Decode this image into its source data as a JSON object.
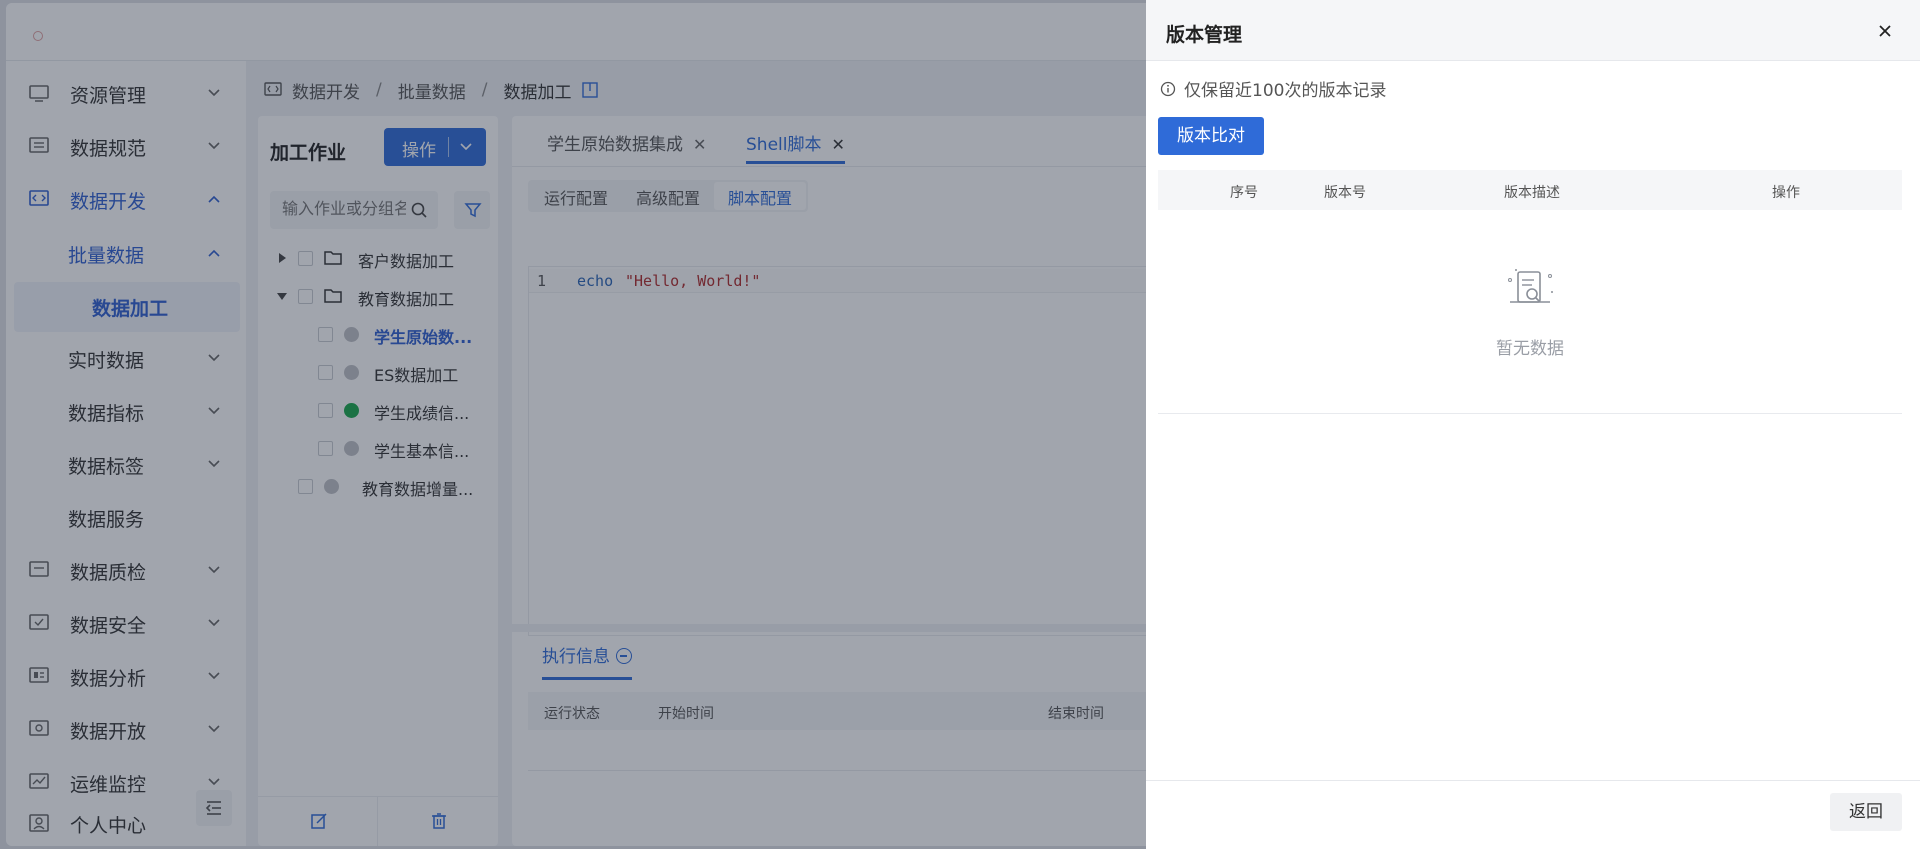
{
  "sidebar": {
    "items": [
      {
        "label": "资源管理",
        "icon": "monitor-icon"
      },
      {
        "label": "数据规范",
        "icon": "spec-icon"
      },
      {
        "label": "数据开发",
        "icon": "code-icon"
      },
      {
        "label": "批量数据"
      },
      {
        "label": "数据加工"
      },
      {
        "label": "实时数据"
      },
      {
        "label": "数据指标"
      },
      {
        "label": "数据标签"
      },
      {
        "label": "数据服务"
      },
      {
        "label": "数据质检",
        "icon": "quality-icon"
      },
      {
        "label": "数据安全",
        "icon": "security-icon"
      },
      {
        "label": "数据分析",
        "icon": "analysis-icon"
      },
      {
        "label": "数据开放",
        "icon": "open-icon"
      },
      {
        "label": "运维监控",
        "icon": "monitor-chart-icon"
      },
      {
        "label": "个人中心",
        "icon": "user-icon"
      }
    ]
  },
  "breadcrumb": {
    "items": [
      "数据开发",
      "批量数据",
      "数据加工"
    ]
  },
  "jobs": {
    "title": "加工作业",
    "action_label": "操作",
    "search_placeholder": "输入作业或分组名称",
    "tree": [
      {
        "label": "客户数据加工"
      },
      {
        "label": "教育数据加工"
      },
      {
        "label": "学生原始数..."
      },
      {
        "label": "ES数据加工"
      },
      {
        "label": "学生成绩信..."
      },
      {
        "label": "学生基本信..."
      },
      {
        "label": "教育数据增量..."
      }
    ]
  },
  "editor": {
    "tabs": [
      {
        "label": "学生原始数据集成"
      },
      {
        "label": "Shell脚本"
      }
    ],
    "subtabs": [
      "运行配置",
      "高级配置",
      "脚本配置"
    ],
    "code": {
      "line": "1",
      "keyword": "echo",
      "string": "\"Hello, World!\""
    },
    "exec_tab": "执行信息",
    "exec_columns": [
      "运行状态",
      "开始时间",
      "结束时间"
    ]
  },
  "drawer": {
    "title": "版本管理",
    "notice": "仅保留近100次的版本记录",
    "compare_label": "版本比对",
    "columns": [
      "序号",
      "版本号",
      "版本描述",
      "操作"
    ],
    "empty_text": "暂无数据",
    "back_label": "返回"
  },
  "colors": {
    "primary": "#2f6bd8",
    "active_text": "#2f5fd0",
    "status_green": "#19a84a"
  }
}
